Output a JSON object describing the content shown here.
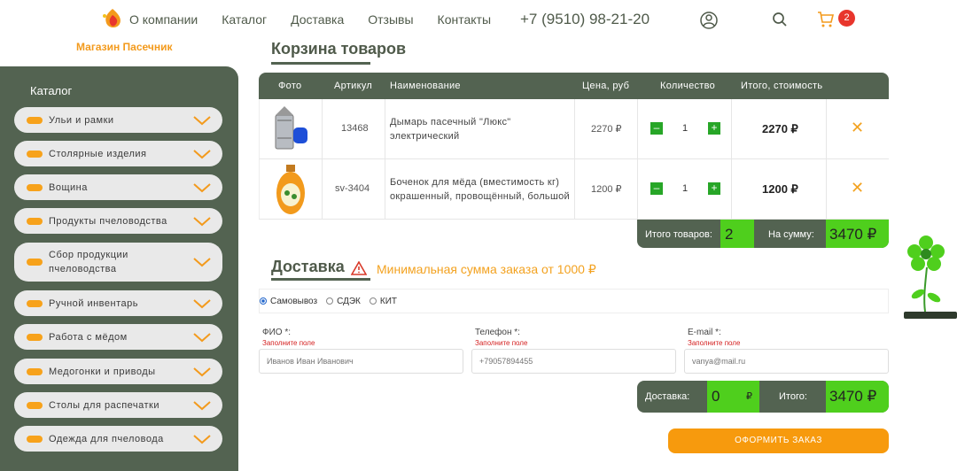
{
  "header": {
    "shop_name": "Магазин Пасечник",
    "nav": [
      "О компании",
      "Каталог",
      "Доставка",
      "Отзывы",
      "Контакты"
    ],
    "phone": "+7 (9510) 98-21-20",
    "cart_count": "2"
  },
  "sidebar": {
    "title": "Каталог",
    "items": [
      "Ульи и рамки",
      "Столярные изделия",
      "Вощина",
      "Продукты пчеловодства",
      "Сбор продукции пчеловодства",
      "Ручной инвентарь",
      "Работа с мёдом",
      "Медогонки и приводы",
      "Столы для распечатки",
      "Одежда для пчеловода"
    ]
  },
  "cart": {
    "title": "Корзина товаров",
    "columns": [
      "Фото",
      "Артикул",
      "Наименование",
      "Цена, руб",
      "Количество",
      "Итого, стоимость"
    ],
    "rows": [
      {
        "sku": "13468",
        "name": "Дымарь пасечный \"Люкс\" электрический",
        "price": "2270 ₽",
        "qty": "1",
        "total": "2270 ₽"
      },
      {
        "sku": "sv-3404",
        "name": "Боченок для мёда (вместимость кг) окрашенный, провощённый, большой",
        "price": "1200 ₽",
        "qty": "1",
        "total": "1200 ₽"
      }
    ],
    "items_label": "Итого товаров:",
    "items_count": "2",
    "sum_label": "На сумму:",
    "sum_value": "3470 ₽"
  },
  "delivery": {
    "title": "Доставка",
    "warning": "Минимальная сумма заказа от 1000 ₽",
    "options": [
      "Самовывоз",
      "СДЭК",
      "КИТ"
    ],
    "fio_label": "ФИО *:",
    "phone_label": "Телефон *:",
    "email_label": "E-mail *:",
    "error": "Заполните поле",
    "fio_placeholder": "Иванов Иван Иванович",
    "phone_placeholder": "+79057894455",
    "email_placeholder": "vanya@mail.ru",
    "delivery_label": "Доставка:",
    "delivery_value": "0",
    "delivery_currency": "₽",
    "total_label": "Итого:",
    "total_value": "3470 ₽",
    "order_button": "ОФОРМИТЬ ЗАКАЗ"
  },
  "colors": {
    "primary": "#536351",
    "accent": "#f79a0d",
    "green": "#4fcf1d"
  }
}
